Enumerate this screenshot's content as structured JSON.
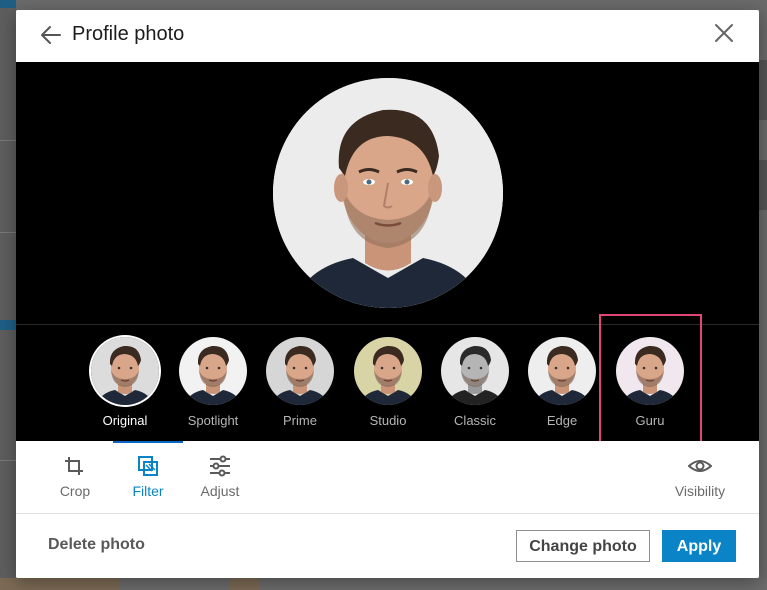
{
  "dialog": {
    "title": "Profile photo",
    "back_icon": "arrow-left-icon",
    "close_icon": "close-icon"
  },
  "filters": {
    "selected": "Original",
    "items": [
      {
        "label": "Original",
        "tone": "#dcdcdc"
      },
      {
        "label": "Spotlight",
        "tone": "#f2f2f2"
      },
      {
        "label": "Prime",
        "tone": "#d6d6d6"
      },
      {
        "label": "Studio",
        "tone": "#d9d4a6"
      },
      {
        "label": "Classic",
        "tone": "#e6e6e6"
      },
      {
        "label": "Edge",
        "tone": "#eeeeee"
      },
      {
        "label": "Guru",
        "tone": "#f0e8ee"
      }
    ],
    "highlighted": "Guru"
  },
  "tools": {
    "crop_label": "Crop",
    "filter_label": "Filter",
    "adjust_label": "Adjust",
    "visibility_label": "Visibility",
    "active": "Filter"
  },
  "footer": {
    "delete_label": "Delete photo",
    "change_label": "Change photo",
    "apply_label": "Apply"
  },
  "colors": {
    "accent": "#0a84c6",
    "highlight_box": "#e0457b",
    "stage_bg": "#000000"
  }
}
